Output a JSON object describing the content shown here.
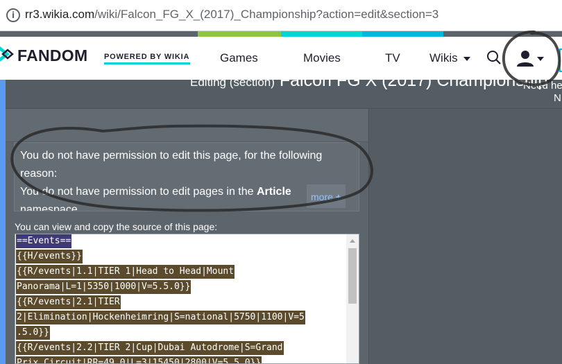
{
  "browser": {
    "url_host": "rr3.wikia.com",
    "url_path": "/wiki/Falcon_FG_X_(2017)_Championship?action=edit&section=3"
  },
  "header": {
    "logo_text": "FANDOM",
    "powered_by": "POWERED BY WIKIA",
    "nav": [
      "Games",
      "Movies",
      "TV",
      "Wikis"
    ]
  },
  "page": {
    "edit_title_prefix": "Editing (section)",
    "edit_title": "Falcon FG X (2017) Championship",
    "need_help": "Need he",
    "need_help_2": "N"
  },
  "permission": {
    "line1": "You do not have permission to edit this page, for the following",
    "line2": "reason:",
    "line3_prefix": "You do not have permission to edit pages in the ",
    "line3_bold": "Article",
    "line4": "namespace",
    "more_label": "more"
  },
  "source": {
    "view_label": "You can view and copy the source of this page:",
    "lines": [
      "==Events==",
      "{{H/events}}",
      "{{R/events|1.1|TIER 1|Head to Head|Mount",
      "Panorama|L=1|5350|1000|V=5.5.0}}",
      "{{R/events|2.1|TIER",
      "2|Elimination|Hockenheimring|S=national|5750|1100|V=5",
      ".5.0}}",
      "{{R/events|2.2|TIER 2|Cup|Dubai Autodrome|S=Grand",
      "Prix Circuit|RR=49.0|L=3|15450|2800|V=5.5.0}}"
    ]
  },
  "colors": {
    "stripe_green": "#8dc63f",
    "stripe_teal": "#00d6d6",
    "stripe_blue": "#00b7e0",
    "source_highlight": "#5b4b2c",
    "source_selection": "#3f3a73"
  }
}
